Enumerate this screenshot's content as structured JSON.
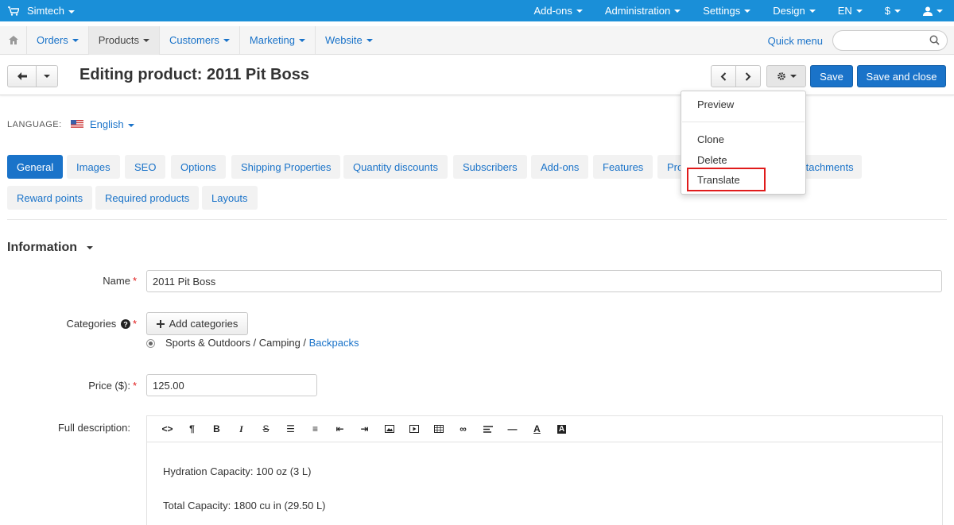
{
  "topbar": {
    "brand": "Simtech",
    "menus": [
      "Add-ons",
      "Administration",
      "Settings",
      "Design",
      "EN",
      "$"
    ],
    "accent": "#1a8fd8"
  },
  "subnav": {
    "items": [
      "Orders",
      "Products",
      "Customers",
      "Marketing",
      "Website"
    ],
    "active": "Products",
    "quick_menu": "Quick menu",
    "search_placeholder": ""
  },
  "titlebar": {
    "title": "Editing product: 2011 Pit Boss",
    "save_label": "Save",
    "save_close_label": "Save and close"
  },
  "dropdown": {
    "items": [
      "Preview",
      "Clone",
      "Delete",
      "Translate"
    ],
    "highlighted": "Translate"
  },
  "language": {
    "label": "LANGUAGE:",
    "value": "English"
  },
  "tabs": {
    "row1": [
      "General",
      "Images",
      "SEO",
      "Options",
      "Shipping Properties",
      "Quantity discounts",
      "Subscribers",
      "Add-ons",
      "Features",
      "Pro",
      "ttachments"
    ],
    "row2": [
      "Reward points",
      "Required products",
      "Layouts"
    ],
    "active": "General"
  },
  "form": {
    "section_title": "Information",
    "name_label": "Name",
    "name_value": "2011 Pit Boss",
    "categories_label": "Categories",
    "add_categories": "Add categories",
    "category_path": "Sports & Outdoors / Camping / ",
    "category_link": "Backpacks",
    "price_label": "Price ($):",
    "price_value": "125.00",
    "description_label": "Full description:",
    "description_lines": [
      "Hydration Capacity: 100 oz (3 L)",
      "Total Capacity: 1800 cu in (29.50 L)"
    ]
  }
}
